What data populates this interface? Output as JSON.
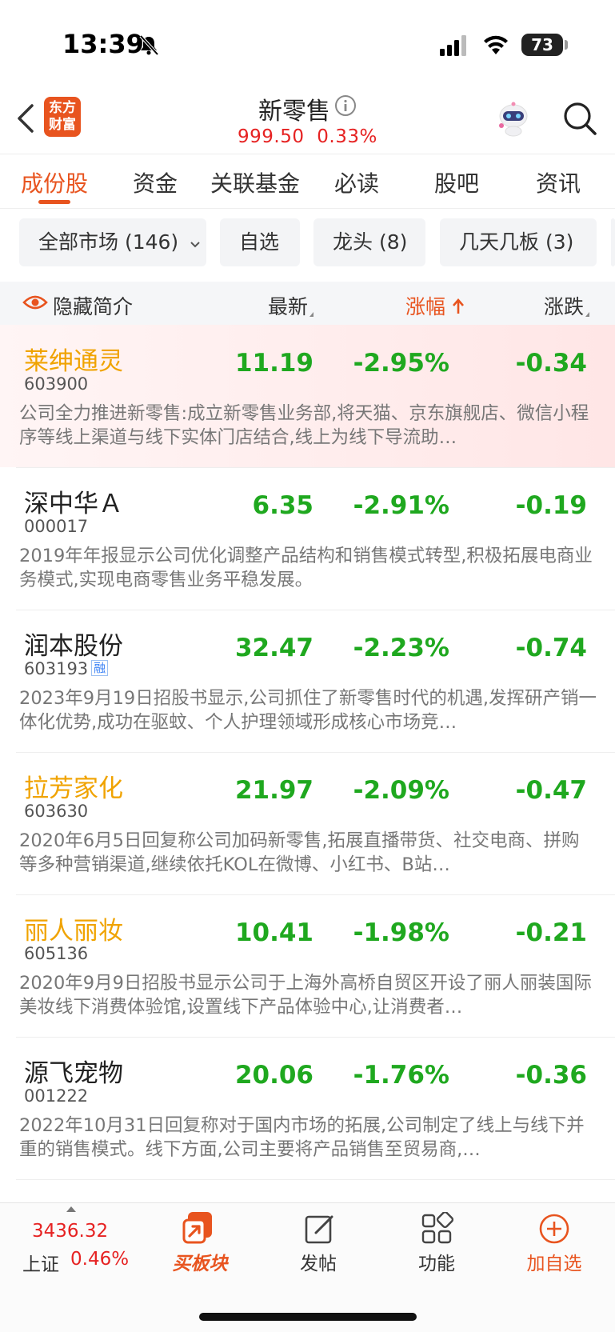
{
  "status_bar": {
    "time": "13:39",
    "battery": "73"
  },
  "header": {
    "logo_text": [
      "东方",
      "财富"
    ],
    "title": "新零售",
    "price": "999.50",
    "change_pct": "0.33%"
  },
  "tabs": [
    {
      "label": "成份股",
      "active": true
    },
    {
      "label": "资金"
    },
    {
      "label": "关联基金"
    },
    {
      "label": "必读"
    },
    {
      "label": "股吧"
    },
    {
      "label": "资讯"
    }
  ],
  "filters": [
    {
      "label": "全部市场 (146)"
    },
    {
      "label": "自选"
    },
    {
      "label": "龙头 (8)"
    },
    {
      "label": "几天几板 (3)"
    }
  ],
  "columns": {
    "toggle": "隐藏简介",
    "latest": "最新",
    "change_pct": "涨幅",
    "change": "涨跌"
  },
  "stocks": [
    {
      "name": "莱绅通灵",
      "code": "603900",
      "price": "11.19",
      "pct": "-2.95%",
      "chg": "-0.34",
      "desc": "公司全力推进新零售:成立新零售业务部,将天猫、京东旗舰店、微信小程序等线上渠道与线下实体门店结合,线上为线下导流助…"
    },
    {
      "name": "深中华Ａ",
      "code": "000017",
      "price": "6.35",
      "pct": "-2.91%",
      "chg": "-0.19",
      "desc": "2019年年报显示公司优化调整产品结构和销售模式转型,积极拓展电商业务模式,实现电商零售业务平稳发展。"
    },
    {
      "name": "润本股份",
      "code": "603193",
      "badge": "融",
      "price": "32.47",
      "pct": "-2.23%",
      "chg": "-0.74",
      "desc": "2023年9月19日招股书显示,公司抓住了新零售时代的机遇,发挥研产销一体化优势,成功在驱蚊、个人护理领域形成核心市场竞…"
    },
    {
      "name": "拉芳家化",
      "code": "603630",
      "price": "21.97",
      "pct": "-2.09%",
      "chg": "-0.47",
      "desc": "2020年6月5日回复称公司加码新零售,拓展直播带货、社交电商、拼购等多种营销渠道,继续依托KOL在微博、小红书、B站…"
    },
    {
      "name": "丽人丽妆",
      "code": "605136",
      "price": "10.41",
      "pct": "-1.98%",
      "chg": "-0.21",
      "desc": "2020年9月9日招股书显示公司于上海外高桥自贸区开设了丽人丽装国际美妆线下消费体验馆,设置线下产品体验中心,让消费者…"
    },
    {
      "name": "源飞宠物",
      "code": "001222",
      "price": "20.06",
      "pct": "-1.76%",
      "chg": "-0.36",
      "desc": "2022年10月31日回复称对于国内市场的拓展,公司制定了线上与线下并重的销售模式。线下方面,公司主要将产品销售至贸易商,…"
    }
  ],
  "bottom_bar": {
    "index_value": "3436.32",
    "index_name": "上证",
    "index_pct": "0.46%",
    "nav": [
      {
        "label": "买板块",
        "icon": "buy-sector-icon"
      },
      {
        "label": "发帖",
        "icon": "compose-icon"
      },
      {
        "label": "功能",
        "icon": "functions-icon"
      },
      {
        "label": "加自选",
        "icon": "add-watchlist-icon"
      }
    ]
  },
  "colors": {
    "accent": "#e8541f",
    "up_red": "#e62222",
    "down_green": "#1fa81f",
    "highlight_name": "#f0a300"
  }
}
